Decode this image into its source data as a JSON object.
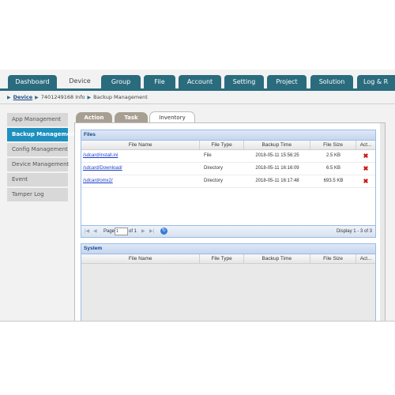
{
  "nav": {
    "tabs": [
      {
        "label": "Dashboard"
      },
      {
        "label": "Device"
      },
      {
        "label": "Group"
      },
      {
        "label": "File"
      },
      {
        "label": "Account"
      },
      {
        "label": "Setting"
      },
      {
        "label": "Project"
      },
      {
        "label": "Solution"
      },
      {
        "label": "Log & R"
      }
    ],
    "active": "Device"
  },
  "breadcrumb": {
    "root": "Device",
    "device": "7401249168 Info",
    "page": "Backup Management"
  },
  "sidebar": {
    "items": [
      {
        "label": "App Management"
      },
      {
        "label": "Backup Management"
      },
      {
        "label": "Config Management"
      },
      {
        "label": "Device Management"
      },
      {
        "label": "Event"
      },
      {
        "label": "Tamper Log"
      }
    ],
    "active": "Backup Management"
  },
  "subtabs": {
    "items": [
      {
        "label": "Action"
      },
      {
        "label": "Task"
      },
      {
        "label": "Inventory"
      }
    ],
    "active": "Inventory"
  },
  "files": {
    "title": "Files",
    "columns": [
      "File Name",
      "File Type",
      "Backup Time",
      "File Size",
      "Act..."
    ],
    "rows": [
      {
        "name": "/sdcard/install.ini",
        "type": "File",
        "time": "2018-05-11 15:56:25",
        "size": "2.5 KB"
      },
      {
        "name": "/sdcard/Download/",
        "type": "Directory",
        "time": "2018-05-11 16:16:09",
        "size": "6.5 KB"
      },
      {
        "name": "/sdcard/omx2/",
        "type": "Directory",
        "time": "2018-05-11 16:17:48",
        "size": "693.5 KB"
      }
    ],
    "pager": {
      "page_label": "Page",
      "page_value": "1",
      "of_label": "of 1",
      "display": "Display 1 - 3 of 3"
    }
  },
  "system": {
    "title": "System",
    "columns": [
      "File Name",
      "File Type",
      "Backup Time",
      "File Size",
      "Act..."
    ]
  },
  "colors": {
    "nav_bg": "#2a6c7e",
    "sidebar_active": "#1e90bf",
    "delete": "#cc1111",
    "link": "#1a3ec8"
  },
  "icons": {
    "delete": "delete-x-icon",
    "breadcrumb_sep": "triangle-right-icon",
    "refresh": "refresh-icon"
  }
}
